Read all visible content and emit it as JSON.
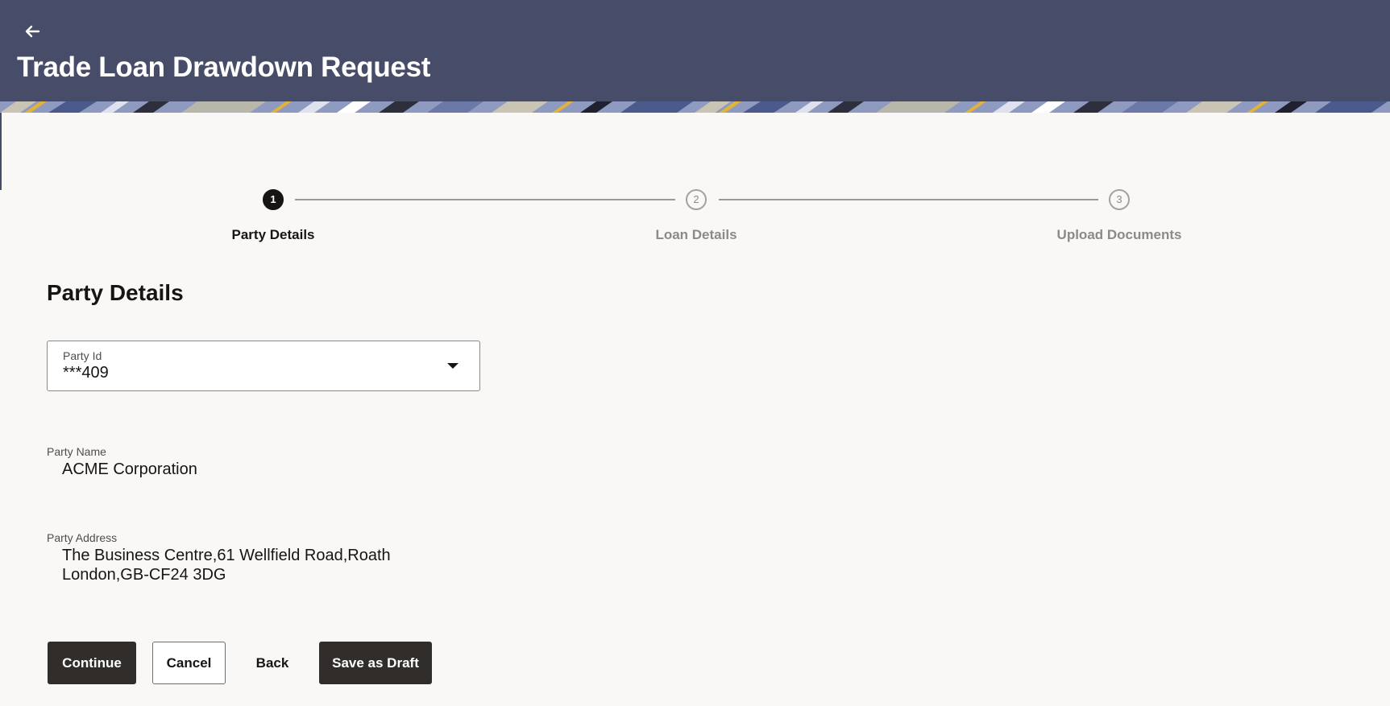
{
  "header": {
    "back_icon": "arrow-left-icon",
    "title": "Trade Loan Drawdown Request",
    "background_color": "#474c69"
  },
  "stepper": {
    "steps": [
      {
        "number": "1",
        "label": "Party Details",
        "state": "active"
      },
      {
        "number": "2",
        "label": "Loan Details",
        "state": "inactive"
      },
      {
        "number": "3",
        "label": "Upload Documents",
        "state": "inactive"
      }
    ]
  },
  "section": {
    "title": "Party Details"
  },
  "party_id": {
    "label": "Party Id",
    "value": "***409",
    "icon": "chevron-down-icon"
  },
  "party_name": {
    "label": "Party Name",
    "value": "ACME Corporation"
  },
  "party_address": {
    "label": "Party Address",
    "line1": "The Business Centre,61 Wellfield Road,Roath",
    "line2": "London,GB-CF24 3DG"
  },
  "actions": {
    "continue_label": "Continue",
    "cancel_label": "Cancel",
    "back_label": "Back",
    "save_draft_label": "Save as Draft"
  },
  "colors": {
    "primary_button": "#312d2a",
    "page_background": "#f9f8f6"
  }
}
